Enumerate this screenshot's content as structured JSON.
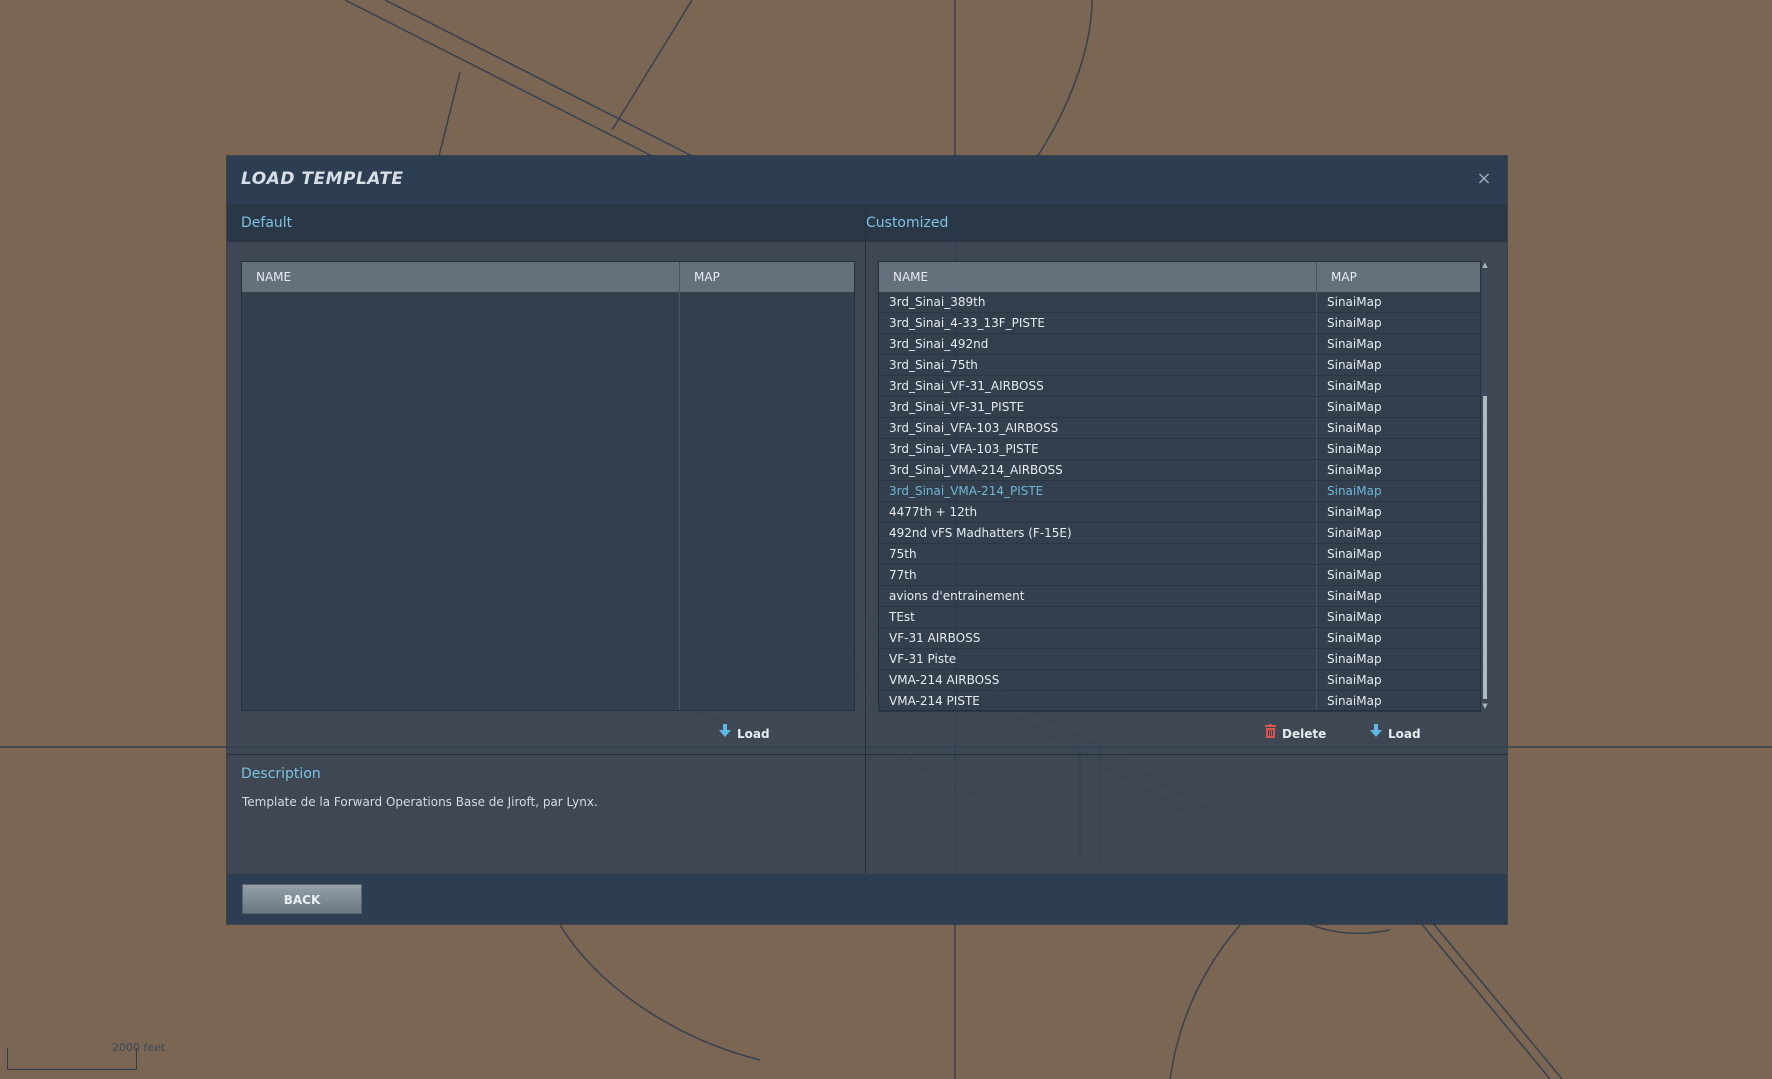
{
  "map": {
    "scale_label": "2000 feet"
  },
  "dialog": {
    "title": "LOAD TEMPLATE",
    "close_glyph": "×",
    "default_section": {
      "title": "Default",
      "columns": [
        "NAME",
        "MAP"
      ],
      "rows": [],
      "load_label": "Load",
      "load_icon": "download-arrow-icon"
    },
    "customized_section": {
      "title": "Customized",
      "columns": [
        "NAME",
        "MAP"
      ],
      "selected_index": 9,
      "rows": [
        {
          "name": "3rd_Sinai_389th",
          "map": "SinaiMap"
        },
        {
          "name": "3rd_Sinai_4-33_13F_PISTE",
          "map": "SinaiMap"
        },
        {
          "name": "3rd_Sinai_492nd",
          "map": "SinaiMap"
        },
        {
          "name": "3rd_Sinai_75th",
          "map": "SinaiMap"
        },
        {
          "name": "3rd_Sinai_VF-31_AIRBOSS",
          "map": "SinaiMap"
        },
        {
          "name": "3rd_Sinai_VF-31_PISTE",
          "map": "SinaiMap"
        },
        {
          "name": "3rd_Sinai_VFA-103_AIRBOSS",
          "map": "SinaiMap"
        },
        {
          "name": "3rd_Sinai_VFA-103_PISTE",
          "map": "SinaiMap"
        },
        {
          "name": "3rd_Sinai_VMA-214_AIRBOSS",
          "map": "SinaiMap"
        },
        {
          "name": "3rd_Sinai_VMA-214_PISTE",
          "map": "SinaiMap"
        },
        {
          "name": "4477th + 12th",
          "map": "SinaiMap"
        },
        {
          "name": "492nd vFS Madhatters (F-15E)",
          "map": "SinaiMap"
        },
        {
          "name": "75th",
          "map": "SinaiMap"
        },
        {
          "name": "77th",
          "map": "SinaiMap"
        },
        {
          "name": "avions d'entrainement",
          "map": "SinaiMap"
        },
        {
          "name": "TEst",
          "map": "SinaiMap"
        },
        {
          "name": "VF-31 AIRBOSS",
          "map": "SinaiMap"
        },
        {
          "name": "VF-31 Piste",
          "map": "SinaiMap"
        },
        {
          "name": "VMA-214  AIRBOSS",
          "map": "SinaiMap"
        },
        {
          "name": "VMA-214 PISTE",
          "map": "SinaiMap"
        }
      ],
      "delete_label": "Delete",
      "delete_icon": "trash-icon",
      "load_label": "Load",
      "load_icon": "download-arrow-icon"
    },
    "description": {
      "title": "Description",
      "text": "Template de la Forward Operations Base de Jiroft, par Lynx."
    },
    "back_label": "BACK"
  },
  "colors": {
    "accent": "#7fc3e0",
    "selected_row": "#6fb8d8",
    "delete_icon": "#d9534f",
    "load_icon": "#5fb8e6"
  }
}
